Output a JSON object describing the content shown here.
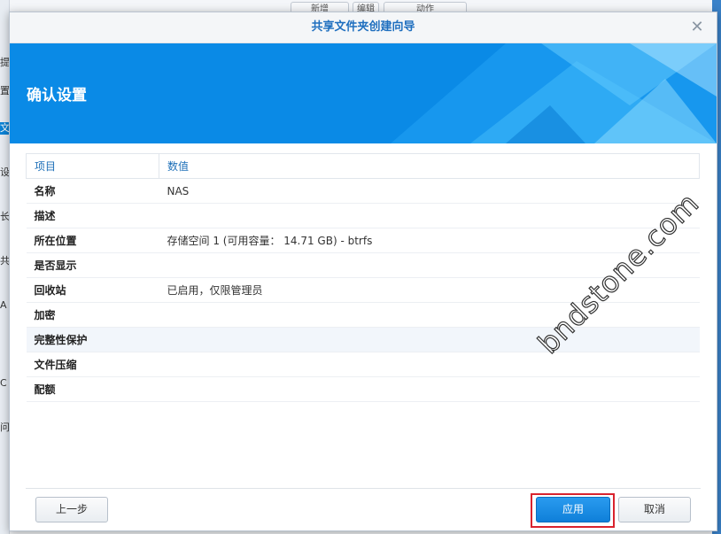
{
  "background": {
    "sidebar_items": [
      "提",
      "置",
      "文件",
      "设",
      "长",
      "共",
      "A",
      "",
      "C",
      "问"
    ],
    "top_buttons": [
      "新增",
      "编辑",
      "动作"
    ]
  },
  "dialog": {
    "title": "共享文件夹创建向导",
    "banner_title": "确认设置",
    "table": {
      "headers": [
        "项目",
        "数值"
      ],
      "rows": [
        {
          "item": "名称",
          "value": "NAS"
        },
        {
          "item": "描述",
          "value": ""
        },
        {
          "item": "所在位置",
          "value": "存储空间 1 (可用容量： 14.71 GB) - btrfs"
        },
        {
          "item": "是否显示",
          "value": ""
        },
        {
          "item": "回收站",
          "value": "已启用，仅限管理员"
        },
        {
          "item": "加密",
          "value": ""
        },
        {
          "item": "完整性保护",
          "value": ""
        },
        {
          "item": "文件压缩",
          "value": ""
        },
        {
          "item": "配额",
          "value": ""
        }
      ]
    },
    "buttons": {
      "prev": "上一步",
      "apply": "应用",
      "cancel": "取消"
    }
  },
  "watermark": "bndstone.com",
  "colors": {
    "accent": "#0a84d8",
    "banner": "#0a8ae6",
    "highlight_box": "#d9232e"
  }
}
